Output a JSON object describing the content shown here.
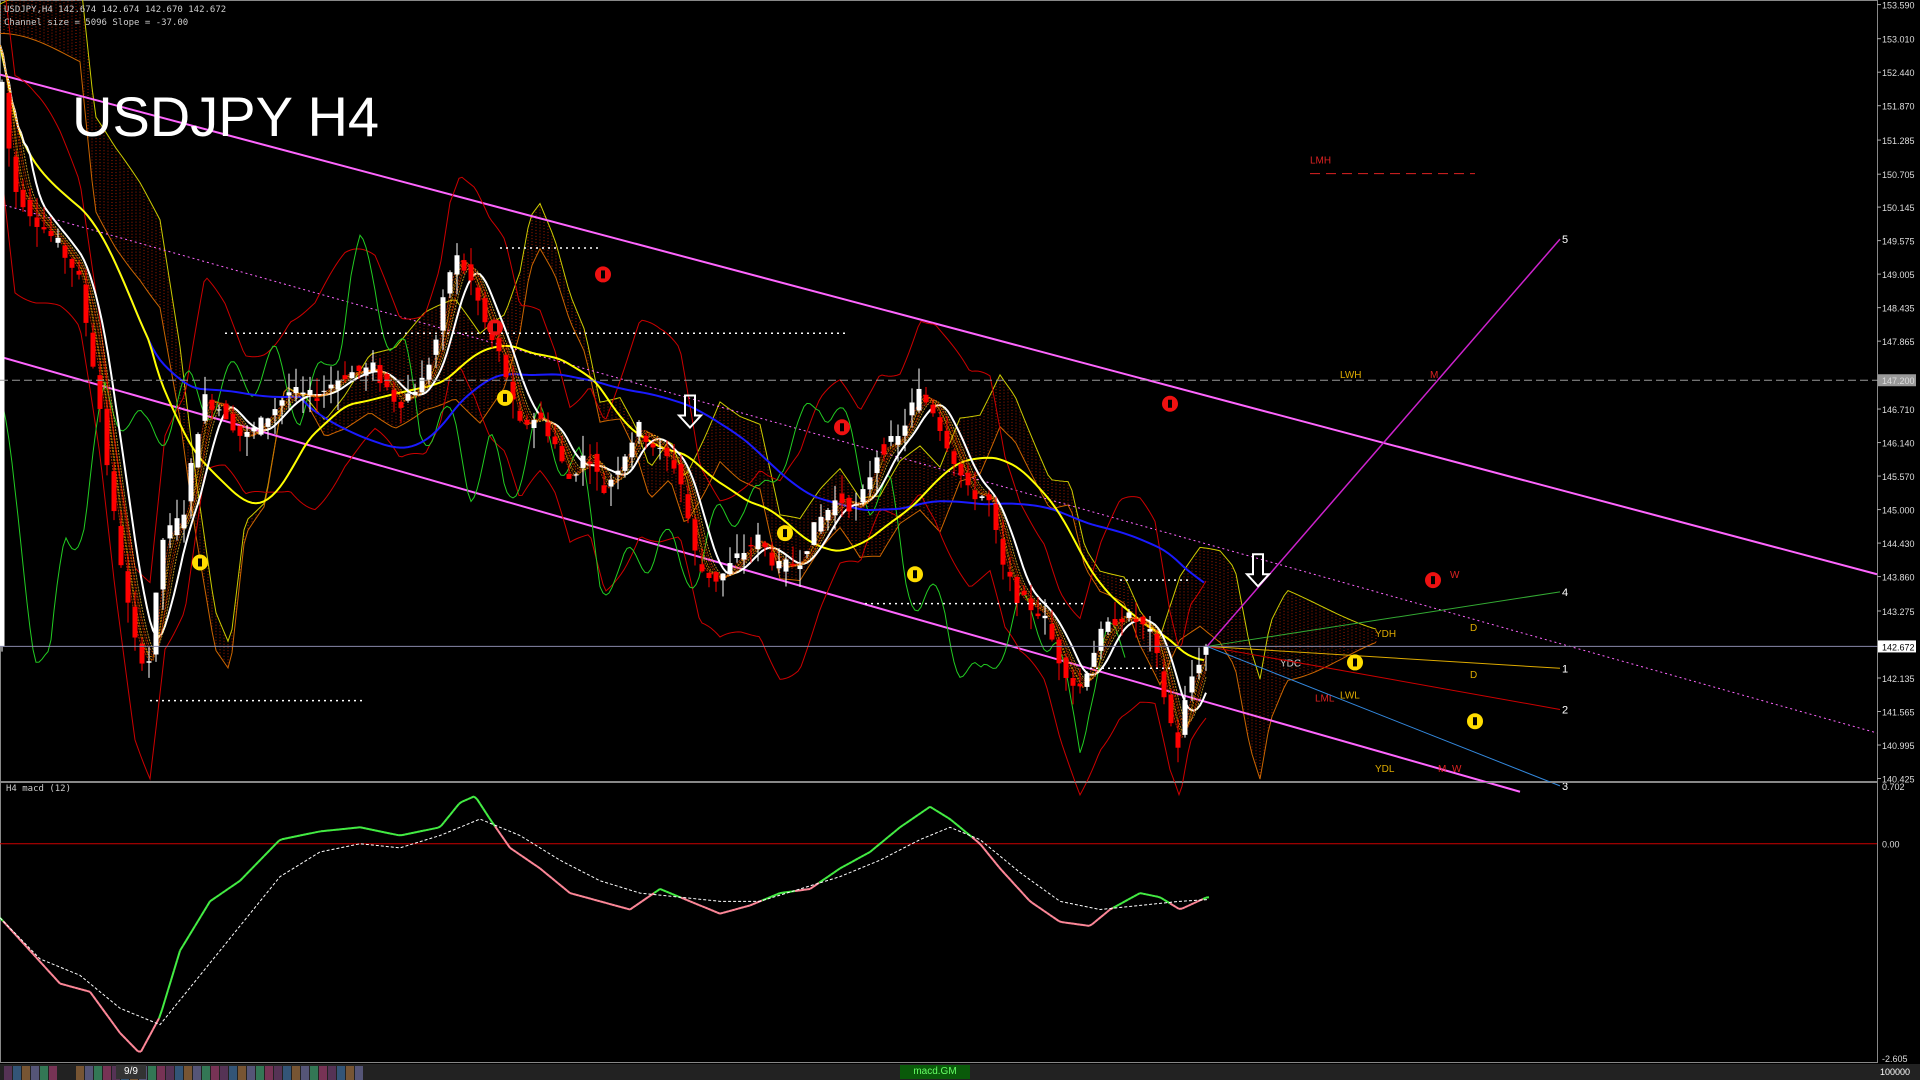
{
  "window": {
    "info_line": "USDJPY,H4  142.674 142.674 142.670 142.672",
    "channel_line": "Channel size = 5096  Slope = -37.00",
    "title": "USDJPY H4",
    "indicator_label": "H4  macd (12)"
  },
  "bottom_bar": {
    "page_label": "9/9",
    "indicator_tab": "macd.GM",
    "volume_label": "100000"
  },
  "colors": {
    "background": "#000000",
    "bull_candle": "#ffffff",
    "bear_candle": "#ff0000",
    "channel": "#ff66ff",
    "ma_white": "#ffffff",
    "ma_yellow": "#ffff00",
    "ma_blue": "#1a1aff",
    "bollinger": "#cc0000",
    "chikou": "#22cc22",
    "macd_up": "#44ee44",
    "macd_down": "#ff8899",
    "price_line": "#8888aa"
  },
  "chart_data": [
    {
      "type": "candlestick",
      "symbol": "USDJPY",
      "timeframe": "H4",
      "title": "USDJPY H4",
      "current_price": 142.672,
      "ylim": [
        140.4,
        153.6
      ],
      "y_ticks": [
        "153.590",
        "153.010",
        "152.440",
        "151.870",
        "151.285",
        "150.705",
        "150.145",
        "149.575",
        "149.005",
        "148.435",
        "147.865",
        "147.200",
        "146.710",
        "146.140",
        "145.570",
        "145.000",
        "144.430",
        "143.860",
        "143.275",
        "142.672",
        "142.135",
        "141.565",
        "140.995",
        "140.425"
      ],
      "y_tick_values": [
        153.59,
        153.01,
        152.44,
        151.87,
        151.285,
        150.705,
        150.145,
        149.575,
        149.005,
        148.435,
        147.865,
        147.2,
        146.71,
        146.14,
        145.57,
        145.0,
        144.43,
        143.86,
        143.275,
        142.672,
        142.135,
        141.565,
        140.995,
        140.425
      ],
      "price_path": [
        [
          0,
          152.9
        ],
        [
          15,
          150.5
        ],
        [
          35,
          150.0
        ],
        [
          60,
          149.5
        ],
        [
          80,
          149.0
        ],
        [
          100,
          147.0
        ],
        [
          115,
          145.0
        ],
        [
          135,
          142.8
        ],
        [
          150,
          142.3
        ],
        [
          165,
          144.5
        ],
        [
          185,
          144.9
        ],
        [
          205,
          146.9
        ],
        [
          225,
          146.7
        ],
        [
          245,
          146.2
        ],
        [
          265,
          146.5
        ],
        [
          290,
          147.0
        ],
        [
          315,
          146.9
        ],
        [
          345,
          147.3
        ],
        [
          375,
          147.4
        ],
        [
          400,
          146.8
        ],
        [
          425,
          147.2
        ],
        [
          440,
          148.0
        ],
        [
          450,
          149.0
        ],
        [
          460,
          149.3
        ],
        [
          475,
          148.8
        ],
        [
          490,
          148.0
        ],
        [
          505,
          147.5
        ],
        [
          520,
          146.4
        ],
        [
          540,
          146.6
        ],
        [
          555,
          146.2
        ],
        [
          570,
          145.5
        ],
        [
          590,
          146.0
        ],
        [
          605,
          145.3
        ],
        [
          625,
          145.9
        ],
        [
          640,
          146.4
        ],
        [
          660,
          146.0
        ],
        [
          680,
          145.7
        ],
        [
          700,
          144.0
        ],
        [
          720,
          143.8
        ],
        [
          740,
          144.2
        ],
        [
          760,
          144.5
        ],
        [
          780,
          144.0
        ],
        [
          800,
          144.1
        ],
        [
          820,
          144.8
        ],
        [
          840,
          145.2
        ],
        [
          860,
          145.0
        ],
        [
          880,
          146.0
        ],
        [
          900,
          146.2
        ],
        [
          920,
          147.0
        ],
        [
          935,
          146.7
        ],
        [
          950,
          146.1
        ],
        [
          970,
          145.3
        ],
        [
          990,
          145.2
        ],
        [
          1005,
          144.0
        ],
        [
          1020,
          143.5
        ],
        [
          1045,
          143.2
        ],
        [
          1060,
          142.5
        ],
        [
          1080,
          141.9
        ],
        [
          1100,
          142.8
        ],
        [
          1120,
          143.2
        ],
        [
          1140,
          143.1
        ],
        [
          1155,
          142.8
        ],
        [
          1170,
          141.5
        ],
        [
          1180,
          141.0
        ],
        [
          1190,
          142.0
        ],
        [
          1200,
          142.4
        ],
        [
          1207,
          142.672
        ]
      ],
      "levels": [
        {
          "label": "LMH",
          "value": 150.85
        },
        {
          "label": "LWH",
          "value": 147.2
        },
        {
          "label": "M",
          "value": 147.2
        },
        {
          "label": "W",
          "value": 143.8
        },
        {
          "label": "YDH",
          "value": 142.8
        },
        {
          "label": "YDC",
          "value": 142.3
        },
        {
          "label": "D",
          "value": 142.1
        },
        {
          "label": "LML",
          "value": 141.7
        },
        {
          "label": "LWL",
          "value": 141.75
        },
        {
          "label": "YDL",
          "value": 140.5
        },
        {
          "label": "D",
          "value": 142.9
        },
        {
          "label": "M",
          "value": 140.5
        },
        {
          "label": "W",
          "value": 140.5
        }
      ],
      "projection_labels": [
        "1",
        "2",
        "3",
        "4",
        "5"
      ],
      "projection_targets": [
        142.3,
        141.6,
        140.3,
        143.6,
        149.6
      ]
    },
    {
      "type": "line",
      "title": "H4  macd (12)",
      "ylim": [
        -2.605,
        0.702
      ],
      "y_ticks": [
        "0.702",
        "0.00",
        "-2.605"
      ],
      "y_tick_values": [
        0.702,
        0.0,
        -2.605
      ],
      "series": [
        {
          "name": "macd",
          "values": [
            [
              0,
              -0.9
            ],
            [
              30,
              -1.3
            ],
            [
              60,
              -1.7
            ],
            [
              90,
              -1.8
            ],
            [
              120,
              -2.3
            ],
            [
              140,
              -2.55
            ],
            [
              160,
              -2.1
            ],
            [
              180,
              -1.3
            ],
            [
              210,
              -0.7
            ],
            [
              240,
              -0.45
            ],
            [
              280,
              0.05
            ],
            [
              320,
              0.15
            ],
            [
              360,
              0.2
            ],
            [
              400,
              0.1
            ],
            [
              440,
              0.2
            ],
            [
              460,
              0.5
            ],
            [
              475,
              0.58
            ],
            [
              490,
              0.3
            ],
            [
              510,
              -0.05
            ],
            [
              540,
              -0.3
            ],
            [
              570,
              -0.6
            ],
            [
              600,
              -0.7
            ],
            [
              630,
              -0.8
            ],
            [
              660,
              -0.55
            ],
            [
              690,
              -0.7
            ],
            [
              720,
              -0.85
            ],
            [
              750,
              -0.75
            ],
            [
              780,
              -0.6
            ],
            [
              810,
              -0.55
            ],
            [
              840,
              -0.3
            ],
            [
              870,
              -0.1
            ],
            [
              900,
              0.2
            ],
            [
              930,
              0.45
            ],
            [
              950,
              0.3
            ],
            [
              980,
              0.0
            ],
            [
              1000,
              -0.3
            ],
            [
              1030,
              -0.7
            ],
            [
              1060,
              -0.95
            ],
            [
              1090,
              -1.0
            ],
            [
              1110,
              -0.8
            ],
            [
              1140,
              -0.6
            ],
            [
              1160,
              -0.65
            ],
            [
              1180,
              -0.8
            ],
            [
              1207,
              -0.65
            ]
          ]
        },
        {
          "name": "signal",
          "values": [
            [
              0,
              -0.9
            ],
            [
              40,
              -1.4
            ],
            [
              80,
              -1.6
            ],
            [
              120,
              -2.0
            ],
            [
              160,
              -2.2
            ],
            [
              200,
              -1.6
            ],
            [
              240,
              -1.0
            ],
            [
              280,
              -0.4
            ],
            [
              320,
              -0.1
            ],
            [
              360,
              0.0
            ],
            [
              400,
              -0.05
            ],
            [
              440,
              0.1
            ],
            [
              480,
              0.3
            ],
            [
              520,
              0.1
            ],
            [
              560,
              -0.2
            ],
            [
              600,
              -0.45
            ],
            [
              640,
              -0.6
            ],
            [
              680,
              -0.65
            ],
            [
              720,
              -0.7
            ],
            [
              760,
              -0.7
            ],
            [
              800,
              -0.55
            ],
            [
              840,
              -0.4
            ],
            [
              880,
              -0.2
            ],
            [
              920,
              0.05
            ],
            [
              950,
              0.2
            ],
            [
              980,
              0.05
            ],
            [
              1020,
              -0.35
            ],
            [
              1060,
              -0.7
            ],
            [
              1100,
              -0.8
            ],
            [
              1140,
              -0.75
            ],
            [
              1180,
              -0.7
            ],
            [
              1207,
              -0.68
            ]
          ]
        }
      ]
    }
  ]
}
